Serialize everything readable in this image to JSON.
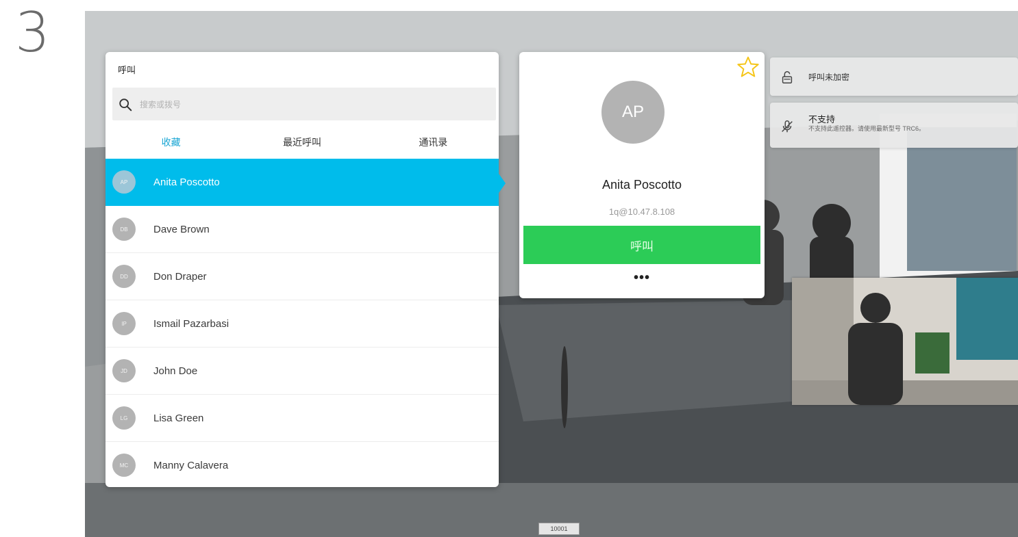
{
  "step_number": "3",
  "call_panel": {
    "title": "呼叫",
    "search": {
      "placeholder": "搜索或拨号",
      "value": ""
    },
    "tabs": [
      {
        "label": "收藏",
        "active": true
      },
      {
        "label": "最近呼叫",
        "active": false
      },
      {
        "label": "通讯录",
        "active": false
      }
    ],
    "contacts": [
      {
        "initials": "AP",
        "name": "Anita Poscotto",
        "selected": true
      },
      {
        "initials": "DB",
        "name": "Dave Brown",
        "selected": false
      },
      {
        "initials": "DD",
        "name": "Don Draper",
        "selected": false
      },
      {
        "initials": "IP",
        "name": "Ismail Pazarbasi",
        "selected": false
      },
      {
        "initials": "JD",
        "name": "John Doe",
        "selected": false
      },
      {
        "initials": "LG",
        "name": "Lisa Green",
        "selected": false
      },
      {
        "initials": "MC",
        "name": "Manny Calavera",
        "selected": false
      }
    ]
  },
  "detail_card": {
    "initials": "AP",
    "name": "Anita Poscotto",
    "address": "1q@10.47.8.108",
    "call_label": "呼叫",
    "more_label": "•••",
    "favorite_icon": "star-outline-icon"
  },
  "notifications": [
    {
      "icon": "lock-open-icon",
      "text": "呼叫未加密"
    },
    {
      "icon": "mic-off-icon",
      "title": "不支持",
      "description": "不支持此遥控器。请使用最新型号 TRC6。"
    }
  ],
  "extension": "10001",
  "colors": {
    "accent_blue": "#00bceb",
    "tab_active": "#1aa6d4",
    "call_green": "#2ccc57",
    "star_yellow": "#f5c518"
  }
}
